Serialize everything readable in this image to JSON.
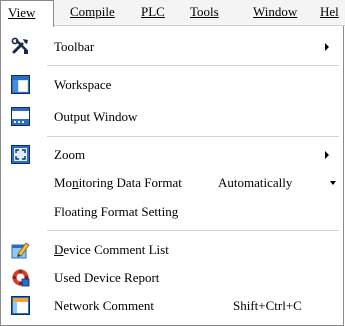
{
  "menubar": {
    "items": [
      {
        "label": "View",
        "active": true
      },
      {
        "label": "Compile"
      },
      {
        "label": "PLC"
      },
      {
        "label": "Tools"
      },
      {
        "label": "Window"
      },
      {
        "label": "Hel"
      }
    ]
  },
  "menu": {
    "toolbar": {
      "label": "Toolbar",
      "icon": "tools-icon"
    },
    "workspace": {
      "label": "Workspace",
      "icon": "workspace-icon"
    },
    "output_window": {
      "label": "Output Window",
      "icon": "output-window-icon"
    },
    "zoom": {
      "label": "Zoom",
      "icon": "zoom-icon"
    },
    "monitoring": {
      "label_pre": "Mo",
      "label_ul": "n",
      "label_post": "itoring Data Format",
      "value": "Automatically"
    },
    "floating": {
      "label": "Floating Format Setting"
    },
    "device_comment": {
      "label_ul": "D",
      "label_post": "evice Comment List",
      "icon": "device-comment-icon"
    },
    "used_device": {
      "label": "Used Device Report",
      "icon": "used-device-report-icon"
    },
    "network_comment": {
      "label": "Network Comment",
      "shortcut": "Shift+Ctrl+C",
      "icon": "network-comment-icon"
    }
  }
}
